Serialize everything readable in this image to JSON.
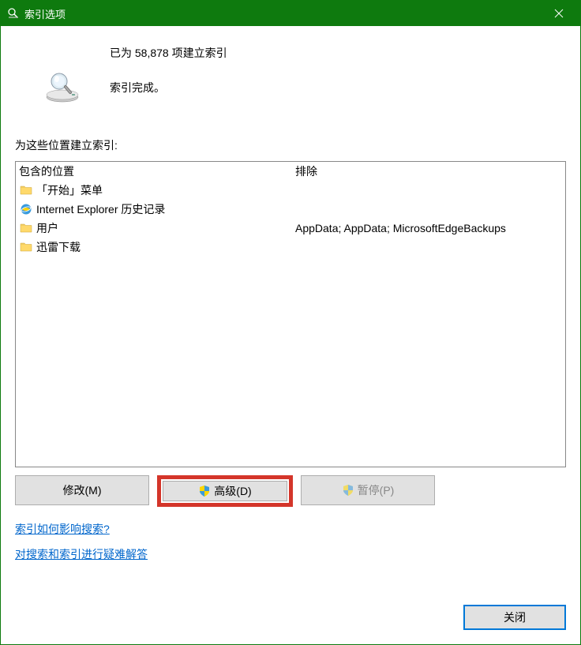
{
  "titlebar": {
    "title": "索引选项"
  },
  "status": {
    "indexed_text": "已为 58,878 项建立索引",
    "complete_text": "索引完成。"
  },
  "section_label": "为这些位置建立索引:",
  "columns": {
    "include": "包含的位置",
    "exclude": "排除"
  },
  "locations": [
    {
      "icon": "folder",
      "name": "「开始」菜单",
      "exclude": ""
    },
    {
      "icon": "ie",
      "name": "Internet Explorer 历史记录",
      "exclude": ""
    },
    {
      "icon": "folder",
      "name": "用户",
      "exclude": "AppData; AppData; MicrosoftEdgeBackups"
    },
    {
      "icon": "folder",
      "name": "迅雷下载",
      "exclude": ""
    }
  ],
  "buttons": {
    "modify": "修改(M)",
    "advanced": "高级(D)",
    "pause": "暂停(P)",
    "close": "关闭"
  },
  "links": {
    "how_affects": "索引如何影响搜索?",
    "troubleshoot": "对搜索和索引进行疑难解答"
  }
}
